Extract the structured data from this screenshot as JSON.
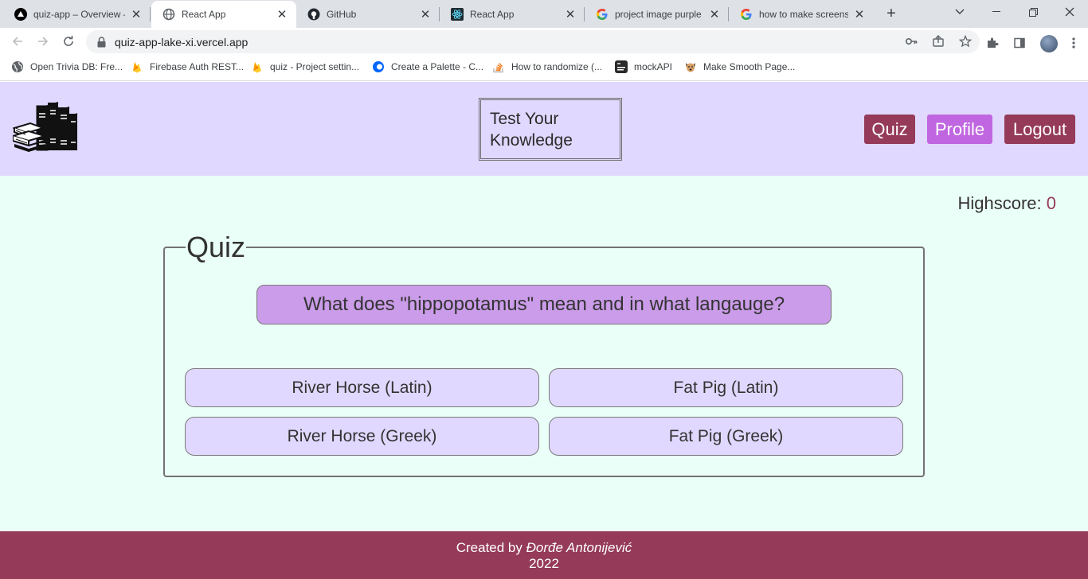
{
  "browser": {
    "tabs": [
      {
        "label": "quiz-app – Overview –",
        "icon": "vercel-icon"
      },
      {
        "label": "React App",
        "icon": "globe-icon"
      },
      {
        "label": "GitHub",
        "icon": "github-icon"
      },
      {
        "label": "React App",
        "icon": "react-icon"
      },
      {
        "label": "project image purple c",
        "icon": "google-icon"
      },
      {
        "label": "how to make screensh",
        "icon": "google-icon"
      }
    ],
    "url": "quiz-app-lake-xi.vercel.app",
    "bookmarks": [
      {
        "label": "Open Trivia DB: Fre...",
        "icon": "globe-icon"
      },
      {
        "label": "Firebase Auth REST...",
        "icon": "firebase-icon"
      },
      {
        "label": "quiz - Project settin...",
        "icon": "firebase-icon"
      },
      {
        "label": "Create a Palette - C...",
        "icon": "coolors-icon"
      },
      {
        "label": "How to randomize (...",
        "icon": "stackoverflow-icon"
      },
      {
        "label": "mockAPI",
        "icon": "mockapi-icon"
      },
      {
        "label": "Make Smooth Page...",
        "icon": "dog-icon"
      }
    ]
  },
  "header": {
    "brand": "Test Your Knowledge",
    "nav": {
      "quiz": "Quiz",
      "profile": "Profile",
      "logout": "Logout"
    }
  },
  "highscore": {
    "label": "Highscore:",
    "value": "0"
  },
  "quiz": {
    "legend": "Quiz",
    "question": "What does \"hippopotamus\" mean and in what langauge?",
    "answers": [
      "River Horse (Latin)",
      "Fat Pig (Latin)",
      "River Horse (Greek)",
      "Fat Pig (Greek)"
    ]
  },
  "footer": {
    "created_by": "Created by",
    "author": "Đorđe Antonijević",
    "year": "2022"
  },
  "colors": {
    "header_bg": "#e0d8fe",
    "page_bg": "#ebfff9",
    "accent": "#953a58",
    "profile": "#c066e0",
    "question_bg": "#cb9ce9"
  }
}
